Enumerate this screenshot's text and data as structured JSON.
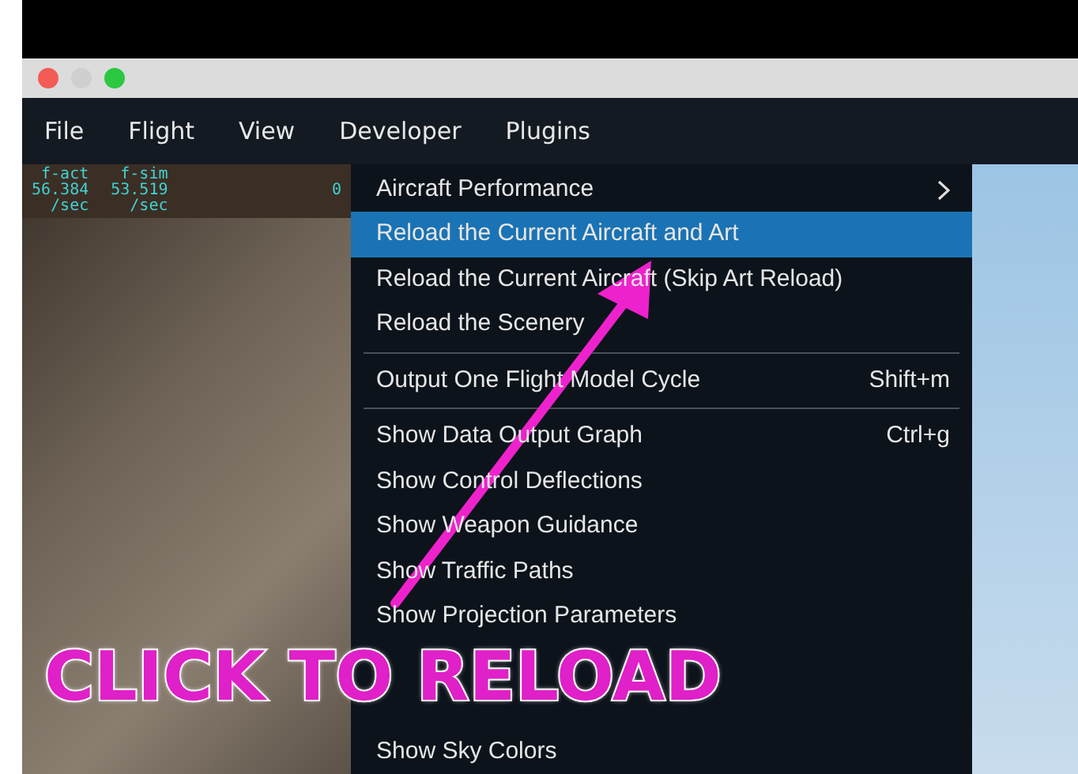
{
  "menu_bar": [
    {
      "label": "File"
    },
    {
      "label": "Flight"
    },
    {
      "label": "View"
    },
    {
      "label": "Developer"
    },
    {
      "label": "Plugins"
    }
  ],
  "stats": {
    "columns": [
      {
        "name": "f-act",
        "value": "56.384",
        "unit": "/sec"
      },
      {
        "name": "f-sim",
        "value": "53.519",
        "unit": "/sec"
      }
    ],
    "extra": "0"
  },
  "menu": [
    {
      "kind": "submenu",
      "label": "Aircraft Performance",
      "selected": false
    },
    {
      "kind": "item",
      "label": "Reload the Current Aircraft and Art",
      "selected": true
    },
    {
      "kind": "item",
      "label": "Reload the Current Aircraft (Skip Art Reload)",
      "selected": false
    },
    {
      "kind": "item",
      "label": "Reload the Scenery",
      "selected": false
    },
    {
      "kind": "separator"
    },
    {
      "kind": "item",
      "label": "Output One Flight Model Cycle",
      "shortcut": "Shift+m",
      "selected": false
    },
    {
      "kind": "separator"
    },
    {
      "kind": "item",
      "label": "Show Data Output Graph",
      "shortcut": "Ctrl+g",
      "selected": false
    },
    {
      "kind": "item",
      "label": "Show Control Deflections",
      "selected": false
    },
    {
      "kind": "item",
      "label": "Show Weapon Guidance",
      "selected": false
    },
    {
      "kind": "item",
      "label": "Show Traffic Paths",
      "selected": false
    },
    {
      "kind": "item",
      "label": "Show Projection Parameters",
      "selected": false
    },
    {
      "kind": "hidden"
    },
    {
      "kind": "hidden"
    },
    {
      "kind": "item",
      "label": "Show Sky Colors",
      "selected": false
    }
  ],
  "annotation": {
    "text": "CLICK TO RELOAD"
  }
}
